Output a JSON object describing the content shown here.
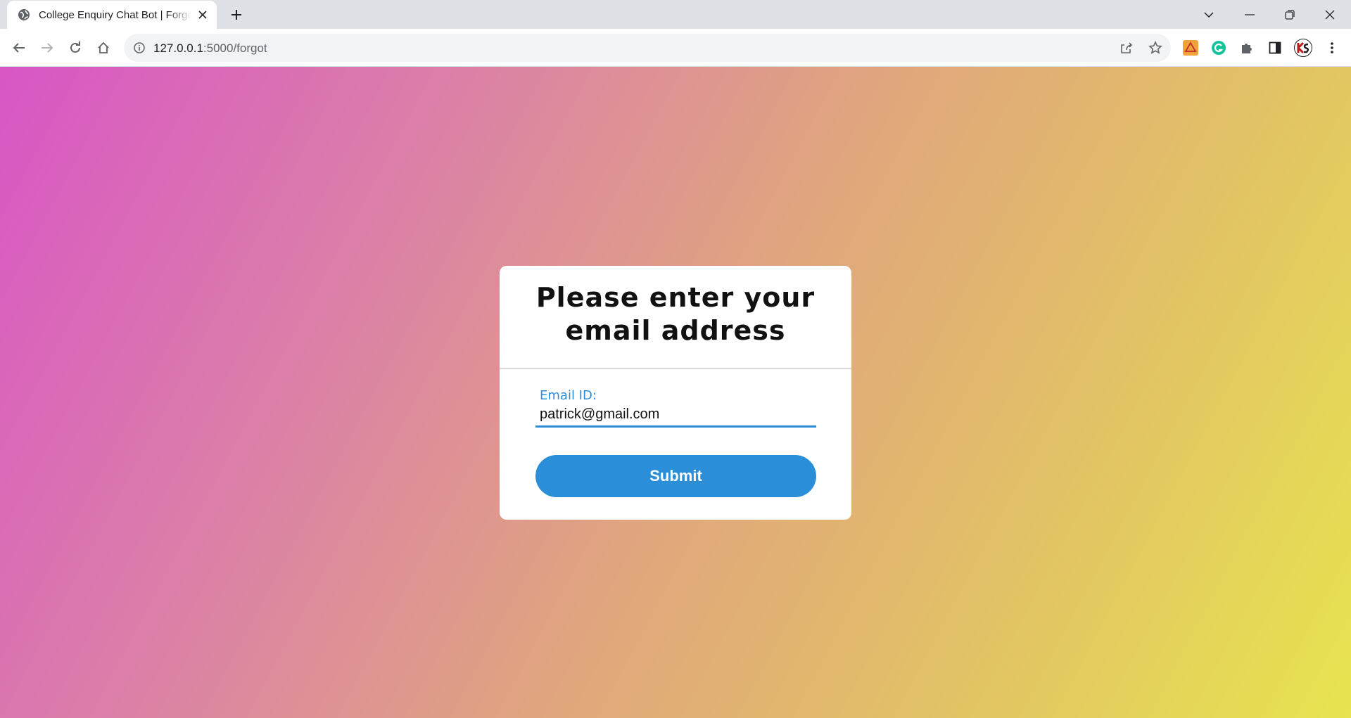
{
  "browser": {
    "tab": {
      "title": "College Enquiry Chat Bot | Forgot Password"
    },
    "address_bar": {
      "host": "127.0.0.1",
      "path": ":5000/forgot"
    },
    "icons": {
      "tab_favicon": "globe-icon",
      "tab_close": "close-icon",
      "new_tab": "plus-icon",
      "back": "back-arrow-icon",
      "forward": "forward-arrow-icon",
      "reload": "reload-icon",
      "home": "home-icon",
      "site_info": "info-icon",
      "share": "share-icon",
      "bookmark": "star-icon",
      "extensions": [
        "google-drive-extension-icon",
        "grammarly-extension-icon",
        "puzzle-extensions-icon",
        "side-panel-icon",
        "profile-avatar"
      ],
      "menu": "kebab-menu-icon",
      "window": [
        "tab-search-icon",
        "minimize-icon",
        "restore-icon",
        "close-window-icon"
      ]
    }
  },
  "page": {
    "background_colors": [
      "#d856c6",
      "#e0a57e",
      "#e7e44f"
    ],
    "card": {
      "title": "Please enter your email address",
      "email_label": "Email ID:",
      "email_value": "patrick@gmail.com",
      "submit_label": "Submit",
      "accent_color": "#2a8fd8"
    }
  }
}
